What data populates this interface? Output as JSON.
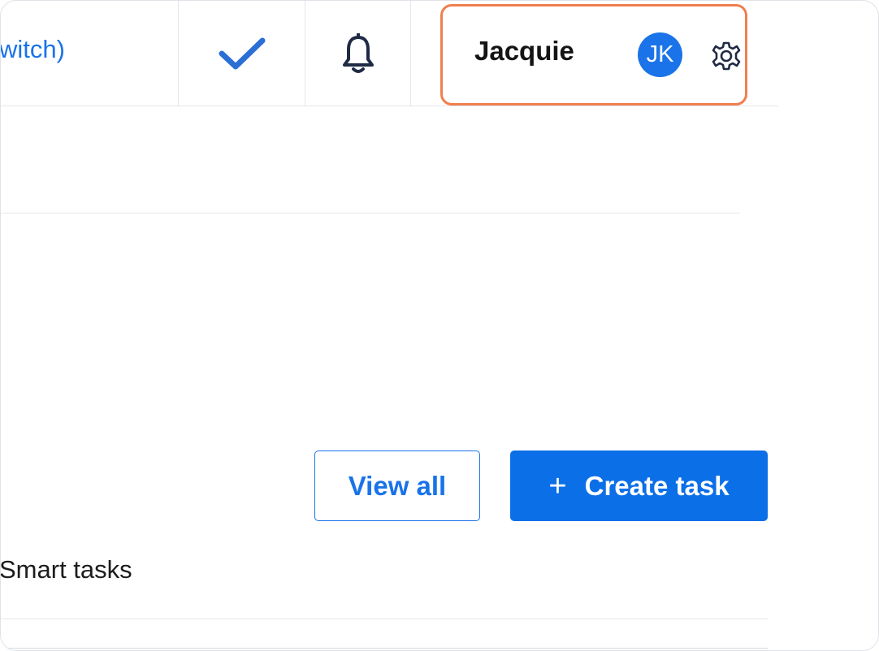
{
  "header": {
    "link_text": "witch)",
    "user_name": "Jacquie",
    "avatar_initials": "JK",
    "icons": [
      "check-icon",
      "bell-icon",
      "gear-icon"
    ]
  },
  "actions": {
    "view_all_label": "View all",
    "create_task_plus": "+",
    "create_task_label": "Create task"
  },
  "section": {
    "smart_tasks_label": "Smart tasks"
  },
  "colors": {
    "accent": "#1a73e8",
    "primary_button": "#0b6fe8",
    "highlight_border": "#f07f4f",
    "icon_dark": "#1f2a44"
  }
}
